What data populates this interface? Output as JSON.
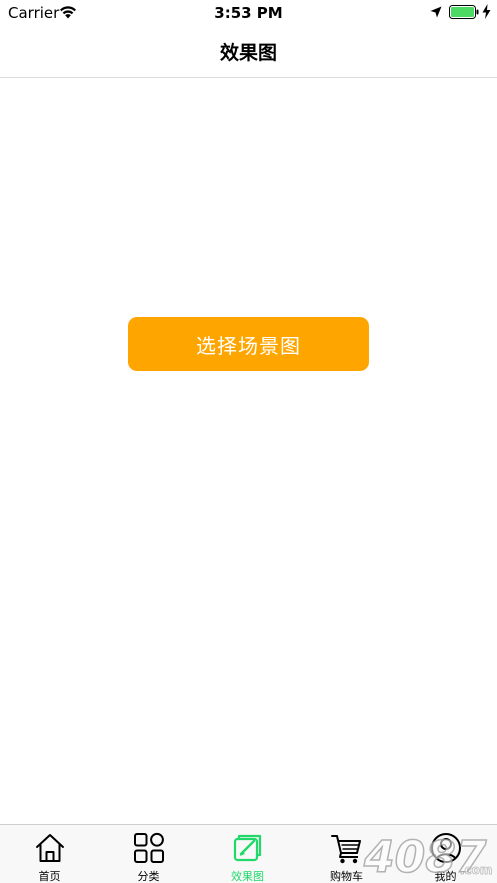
{
  "status_bar": {
    "carrier": "Carrier",
    "time": "3:53 PM",
    "battery_color": "#4cd964"
  },
  "nav": {
    "title": "效果图"
  },
  "main": {
    "choose_scene_label": "选择场景图",
    "button_color": "#ffa500"
  },
  "tab_bar": {
    "active_color": "#21d96b",
    "items": [
      {
        "label": "首页",
        "icon": "home-icon"
      },
      {
        "label": "分类",
        "icon": "grid-icon"
      },
      {
        "label": "效果图",
        "icon": "design-icon",
        "active": true
      },
      {
        "label": "购物车",
        "icon": "cart-icon"
      },
      {
        "label": "我的",
        "icon": "user-icon"
      }
    ]
  },
  "watermark": {
    "text": "4087",
    "suffix": ".com"
  }
}
